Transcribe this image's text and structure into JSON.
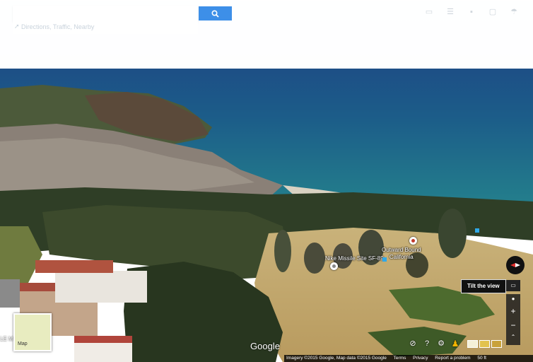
{
  "search": {
    "placeholder": "",
    "directions_text": "Directions, Traffic, Nearby"
  },
  "labels": {
    "outward_bound": "Outward Bound\nCalifornia",
    "nike_missile": "Nike Missile Site SF-89",
    "side_label": "LE M"
  },
  "logo": "Google",
  "map_thumb": {
    "label": "Map"
  },
  "tooltip": "Tilt the view",
  "zoom": {
    "in": "+",
    "out": "−"
  },
  "attribution": {
    "imagery": "Imagery ©2015 Google, Map data ©2015 Google",
    "terms": "Terms",
    "privacy": "Privacy",
    "report": "Report a problem",
    "scale": "50 ft"
  },
  "colors": {
    "search_button": "#3d8fe8",
    "pegman": "#f2b400",
    "ocean": "#1f7a8c"
  }
}
